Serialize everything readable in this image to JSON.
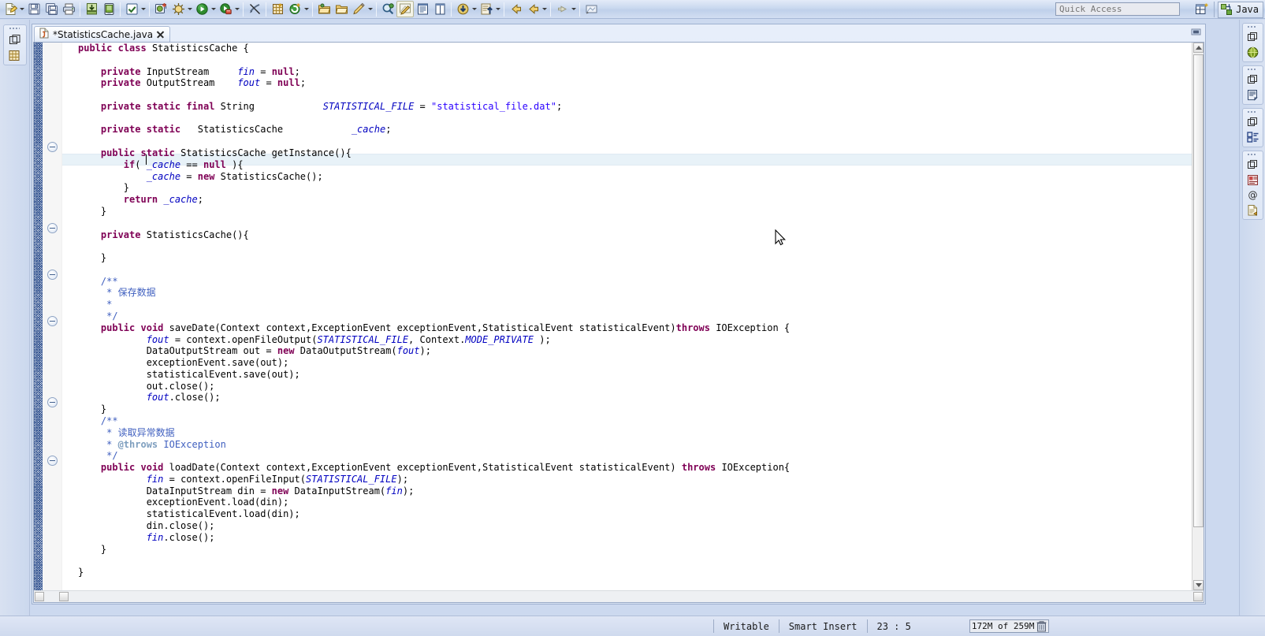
{
  "window": {
    "perspective_label": "Java",
    "quick_access_placeholder": "Quick Access"
  },
  "toolbar": {
    "groups": [
      {
        "buttons": [
          {
            "name": "new-wizard",
            "icon": "new-file-icon",
            "has_arrow": true,
            "pressed": false
          },
          {
            "name": "save",
            "icon": "save-icon",
            "has_arrow": false,
            "pressed": false
          },
          {
            "name": "save-all",
            "icon": "save-all-icon",
            "has_arrow": false,
            "pressed": false
          },
          {
            "name": "print",
            "icon": "print-icon",
            "has_arrow": false,
            "pressed": false
          }
        ]
      },
      {
        "buttons": [
          {
            "name": "import",
            "icon": "import-icon",
            "has_arrow": false,
            "pressed": false
          },
          {
            "name": "android-sdk-manager",
            "icon": "android-sdk-icon",
            "has_arrow": false,
            "pressed": false
          }
        ]
      },
      {
        "buttons": [
          {
            "name": "build-all",
            "icon": "checkbox-icon",
            "has_arrow": true,
            "pressed": false
          }
        ]
      },
      {
        "buttons": [
          {
            "name": "new-android-project",
            "icon": "android-project-icon",
            "has_arrow": false,
            "pressed": false
          },
          {
            "name": "debug",
            "icon": "debug-bug-icon",
            "has_arrow": true,
            "pressed": false
          },
          {
            "name": "run",
            "icon": "run-green-icon",
            "has_arrow": true,
            "pressed": false
          },
          {
            "name": "run-last-tool",
            "icon": "run-external-icon",
            "has_arrow": true,
            "pressed": false
          }
        ]
      },
      {
        "buttons": [
          {
            "name": "skip-breakpoints",
            "icon": "skip-breakpoints-icon",
            "has_arrow": false,
            "pressed": false
          }
        ]
      },
      {
        "buttons": [
          {
            "name": "new-java-package",
            "icon": "package-icon",
            "has_arrow": false,
            "pressed": false
          },
          {
            "name": "new-java-class",
            "icon": "new-class-icon",
            "has_arrow": true,
            "pressed": false
          }
        ]
      },
      {
        "buttons": [
          {
            "name": "open-type",
            "icon": "open-folder-icon",
            "has_arrow": false,
            "pressed": false
          },
          {
            "name": "open-task",
            "icon": "open-folder2-icon",
            "has_arrow": false,
            "pressed": false
          },
          {
            "name": "toggle-mark-occurrences",
            "icon": "pencil-icon",
            "has_arrow": true,
            "pressed": false
          }
        ]
      },
      {
        "buttons": [
          {
            "name": "search",
            "icon": "search-icon",
            "has_arrow": false,
            "pressed": false
          },
          {
            "name": "annotate",
            "icon": "annotate-icon",
            "has_arrow": false,
            "pressed": true
          },
          {
            "name": "show-whitespace",
            "icon": "whitespace-icon",
            "has_arrow": false,
            "pressed": false
          },
          {
            "name": "column-layout",
            "icon": "column-icon",
            "has_arrow": false,
            "pressed": false
          }
        ]
      },
      {
        "buttons": [
          {
            "name": "previous-annotation",
            "icon": "down-arrow-icon",
            "has_arrow": true,
            "pressed": false
          },
          {
            "name": "next-annotation",
            "icon": "up-arrow-icon",
            "has_arrow": true,
            "pressed": false
          }
        ]
      },
      {
        "buttons": [
          {
            "name": "back-history",
            "icon": "back-arrow-icon",
            "has_arrow": false,
            "pressed": false
          },
          {
            "name": "forward-history",
            "icon": "forward-arrow-icon",
            "has_arrow": true,
            "pressed": false
          }
        ]
      },
      {
        "buttons": [
          {
            "name": "forward-nav",
            "icon": "right-arrow-icon",
            "has_arrow": true,
            "pressed": false
          }
        ]
      },
      {
        "buttons": [
          {
            "name": "pin-editor",
            "icon": "pin-icon",
            "has_arrow": false,
            "pressed": false
          }
        ]
      }
    ]
  },
  "left_minimized_bar": {
    "stacks": [
      {
        "name": "package-explorer-stack",
        "restore_icon": "restore-icon",
        "view_icon": "package-explorer-icon"
      }
    ]
  },
  "right_minimized_bar": {
    "stacks": [
      {
        "name": "outline-stack",
        "restore_icon": "restore-icon",
        "view_icon": "outline-globe-icon"
      },
      {
        "name": "console-stack",
        "restore_icon": "restore-icon",
        "view_icon": "console-icon"
      },
      {
        "name": "properties-stack",
        "restore_icon": "restore-icon",
        "view_icon": "properties-icon"
      },
      {
        "name": "logcat-stack",
        "restore_icon": "restore-icon",
        "view_icon": "logcat-icon"
      }
    ],
    "extra_icons": [
      {
        "name": "at-sign-icon"
      },
      {
        "name": "javadoc-icon"
      }
    ]
  },
  "editor": {
    "tab": {
      "label": "*StatisticsCache.java",
      "icon": "java-file-icon",
      "dirty": true,
      "close_label": "close-tab"
    },
    "window_buttons": [
      {
        "name": "minimize-editor-button",
        "icon": "minimize-icon"
      },
      {
        "name": "maximize-editor-button",
        "icon": "maximize-icon"
      }
    ],
    "caret_line": 23,
    "fold_marker_lines": [
      10,
      17,
      21,
      25,
      34,
      38
    ],
    "code_lines": [
      "public class StatisticsCache {",
      "",
      "    private InputStream     fin = null;",
      "    private OutputStream    fout = null;",
      "",
      "    private static final String            STATISTICAL_FILE = \"statistical_file.dat\";",
      "",
      "    private static   StatisticsCache            _cache;",
      "",
      "    public static StatisticsCache getInstance(){",
      "        if( _cache == null ){",
      "            _cache = new StatisticsCache();",
      "        }",
      "        return _cache;",
      "    }",
      "",
      "    private StatisticsCache(){",
      "",
      "    }",
      "",
      "    /**",
      "     * 保存数据",
      "     *",
      "     */",
      "    public void saveDate(Context context,ExceptionEvent exceptionEvent,StatisticalEvent statisticalEvent)throws IOException {",
      "            fout = context.openFileOutput(STATISTICAL_FILE, Context.MODE_PRIVATE );",
      "            DataOutputStream out = new DataOutputStream(fout);",
      "            exceptionEvent.save(out);",
      "            statisticalEvent.save(out);",
      "            out.close();",
      "            fout.close();",
      "    }",
      "    /**",
      "     * 读取异常数据",
      "     * @throws IOException",
      "     */",
      "    public void loadDate(Context context,ExceptionEvent exceptionEvent,StatisticalEvent statisticalEvent) throws IOException{",
      "            fin = context.openFileInput(STATISTICAL_FILE);",
      "            DataInputStream din = new DataInputStream(fin);",
      "            exceptionEvent.load(din);",
      "            statisticalEvent.load(din);",
      "            din.close();",
      "            fin.close();",
      "    }",
      "",
      "}"
    ]
  },
  "status_bar": {
    "writable": "Writable",
    "insert_mode": "Smart Insert",
    "cursor_position": "23 : 5",
    "memory": "172M of 259M",
    "memory_used_percent": 66,
    "trash_icon": "trash-icon"
  },
  "colors": {
    "keyword": "#7f0055",
    "string": "#2a00ff",
    "comment": "#3f5fbf",
    "javadoc_tag": "#7f9fbf",
    "field": "#0000c0",
    "editor_bg": "#ffffff",
    "chrome_bg": "#ccd9ef",
    "current_line": "#e8f2f8"
  }
}
